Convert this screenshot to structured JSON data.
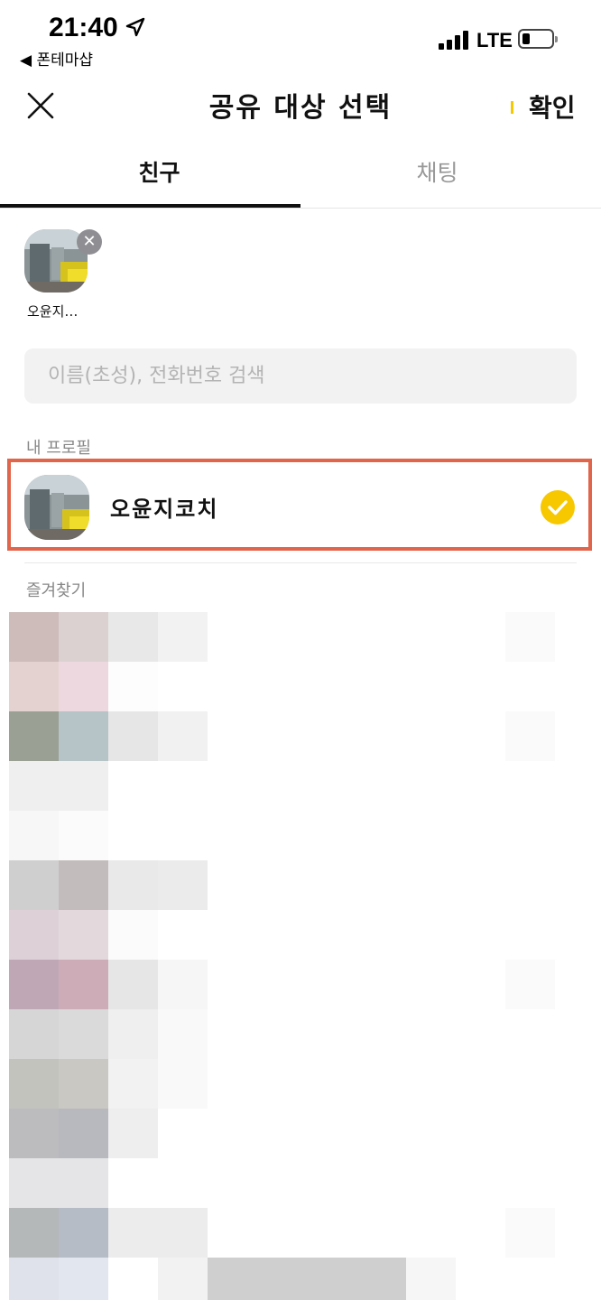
{
  "status_bar": {
    "time": "21:40",
    "back_app": "◀ 폰테마샵",
    "network": "LTE"
  },
  "header": {
    "title": "공유 대상 선택",
    "confirm_label": "확인",
    "close_icon": "close-icon"
  },
  "tabs": [
    {
      "label": "친구",
      "active": true
    },
    {
      "label": "채팅",
      "active": false
    }
  ],
  "selected_chip": {
    "name": "오윤지…",
    "remove_symbol": "✕"
  },
  "search": {
    "placeholder": "이름(초성), 전화번호 검색",
    "value": ""
  },
  "sections": {
    "my_profile_label": "내 프로필",
    "favorites_label": "즐겨찾기"
  },
  "profile": {
    "name": "오윤지코치",
    "checked": true
  },
  "colors": {
    "accent_yellow": "#f7c800",
    "highlight_border": "#e0654a"
  }
}
